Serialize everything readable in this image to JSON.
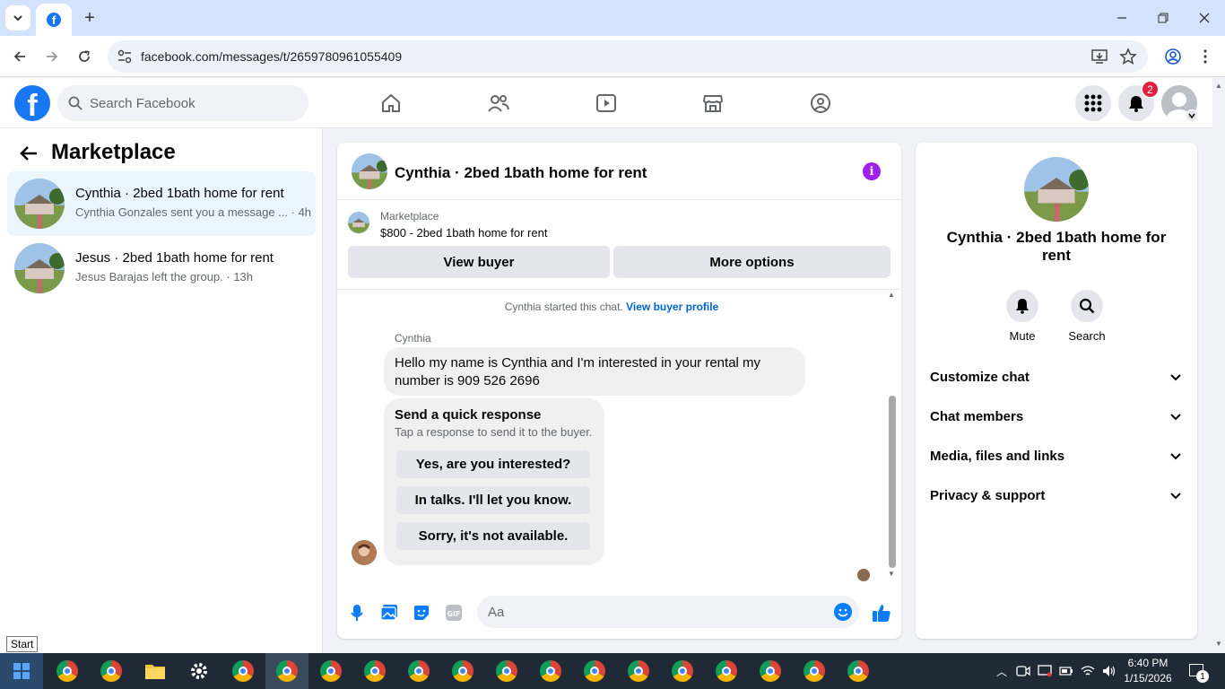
{
  "browser": {
    "url": "facebook.com/messages/t/2659780961055409"
  },
  "header": {
    "search_placeholder": "Search Facebook",
    "notification_count": "2"
  },
  "sidebar": {
    "title": "Marketplace",
    "conversations": [
      {
        "name": "Cynthia · 2bed 1bath home for rent",
        "preview": "Cynthia Gonzales sent you a message ... · 4h",
        "active": true
      },
      {
        "name": "Jesus · 2bed 1bath home for rent",
        "preview": "Jesus Barajas left the group. · 13h",
        "active": false
      }
    ]
  },
  "chat": {
    "title": "Cynthia · 2bed 1bath home for rent",
    "marketplace_label": "Marketplace",
    "listing": "$800 - 2bed 1bath home for rent",
    "view_buyer": "View buyer",
    "more_options": "More options",
    "started_text": "Cynthia started this chat.",
    "view_profile": "View buyer profile",
    "sender": "Cynthia",
    "message": "Hello my name is Cynthia and I'm interested in your rental my number is 909 526 2696",
    "quick_title": "Send a quick response",
    "quick_sub": "Tap a response to send it to the buyer.",
    "quick_responses": [
      "Yes, are you interested?",
      "In talks. I'll let you know.",
      "Sorry, it's not available."
    ],
    "composer_placeholder": "Aa"
  },
  "info_panel": {
    "name": "Cynthia · 2bed 1bath home for rent",
    "mute": "Mute",
    "search": "Search",
    "sections": [
      "Customize chat",
      "Chat members",
      "Media, files and links",
      "Privacy & support"
    ]
  },
  "taskbar": {
    "start_tooltip": "Start",
    "time": "6:40 PM",
    "date": "1/15/2026",
    "notif_count": "1"
  },
  "colors": {
    "fb_blue": "#1877f2",
    "active_conv": "#ebf5ff",
    "link": "#0064d1",
    "info_purple": "#a020f0"
  }
}
